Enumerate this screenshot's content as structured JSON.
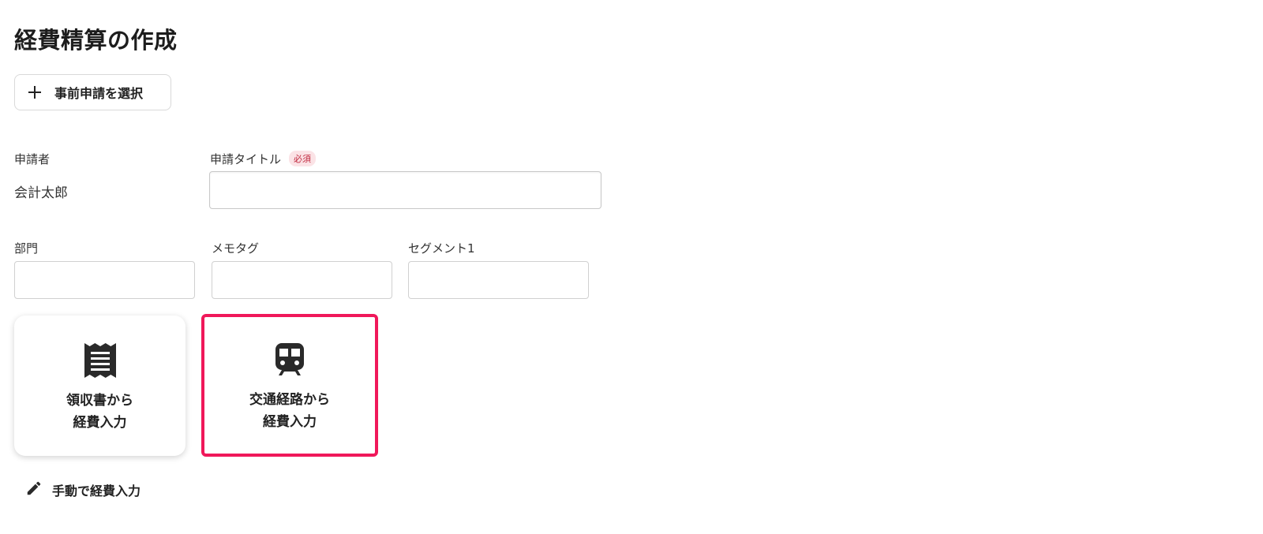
{
  "page": {
    "title": "経費精算の作成"
  },
  "prerequest_button": {
    "label": "事前申請を選択",
    "icon": "plus-icon"
  },
  "applicant": {
    "label": "申請者",
    "value": "会計太郎"
  },
  "title_field": {
    "label": "申請タイトル",
    "required_badge": "必須",
    "value": ""
  },
  "department_field": {
    "label": "部門",
    "value": ""
  },
  "memotag_field": {
    "label": "メモタグ",
    "value": ""
  },
  "segment_field": {
    "label": "セグメント1",
    "value": ""
  },
  "cards": [
    {
      "line1": "領収書から",
      "line2": "経費入力",
      "icon": "receipt-icon"
    },
    {
      "line1": "交通経路から",
      "line2": "経費入力",
      "icon": "train-icon"
    }
  ],
  "manual_entry": {
    "label": "手動で経費入力",
    "icon": "pencil-icon"
  },
  "colors": {
    "highlight": "#f0185a",
    "required_badge_bg": "#fbe3e6",
    "required_badge_text": "#c0283e"
  }
}
